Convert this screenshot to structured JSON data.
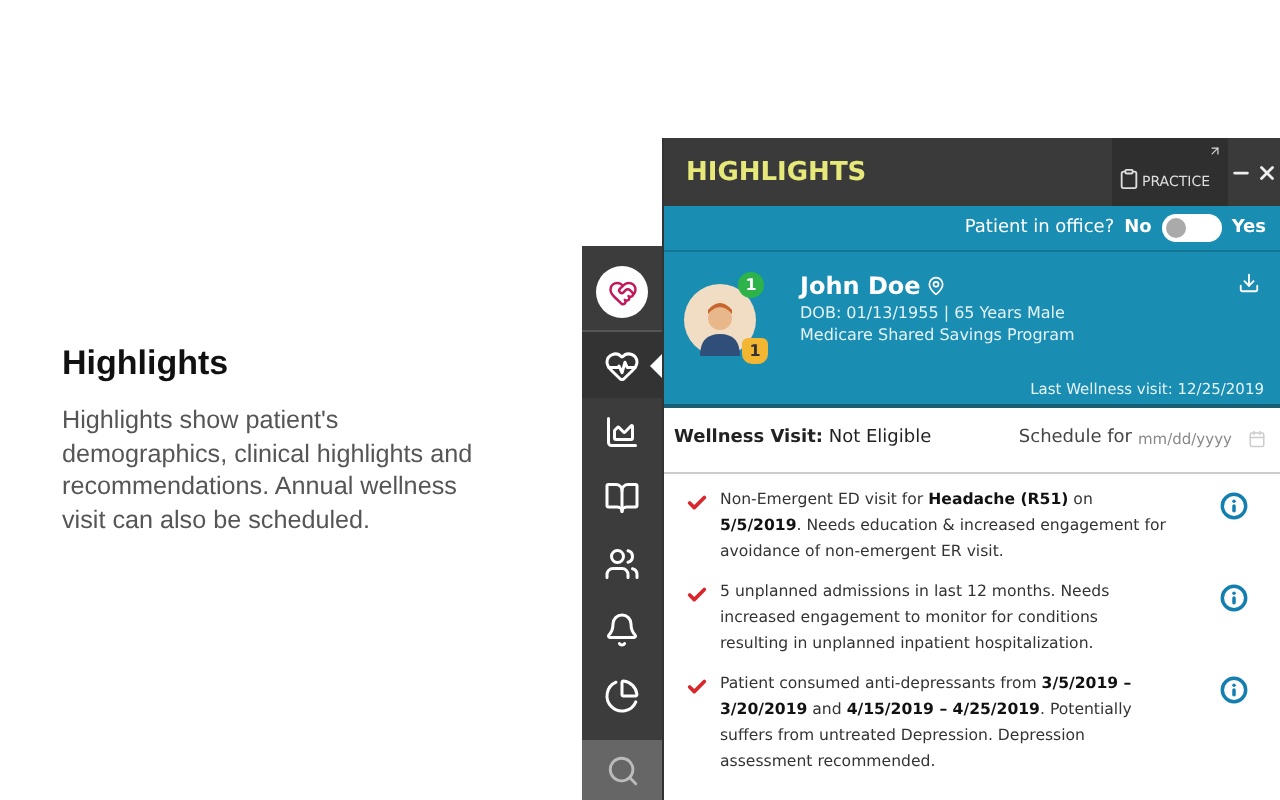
{
  "intro": {
    "title": "Highlights",
    "text": "Highlights show patient's demographics, clinical highlights and recommendations. Annual wellness visit can also be scheduled."
  },
  "sidebar": {
    "items": [
      {
        "selected": true
      },
      {
        "selected": false
      },
      {
        "selected": false
      },
      {
        "selected": false
      },
      {
        "selected": false
      },
      {
        "selected": false
      }
    ]
  },
  "panel": {
    "title": "HIGHLIGHTS",
    "practice_label": "PRACTICE",
    "office": {
      "question": "Patient in office?",
      "off_label": "No",
      "on_label": "Yes",
      "on": false
    },
    "patient": {
      "name": "John Doe",
      "details": "DOB: 01/13/1955 | 65 Years Male",
      "program": "Medicare Shared Savings Program",
      "message_count": "1",
      "alert_count": "1",
      "last_visit": "Last Wellness visit: 12/25/2019"
    },
    "wellness": {
      "label": "Wellness Visit:",
      "value": "Not Eligible",
      "schedule_label": "Schedule for",
      "placeholder": "mm/dd/yyyy"
    },
    "highlights": [
      {
        "text": "Non-Emergent ED visit for **Headache (R51)** on **5/5/2019**. Needs education & increased engagement for avoidance of non-emergent ER visit."
      },
      {
        "text": "5 unplanned admissions in last 12 months. Needs increased engagement to monitor for conditions resulting in unplanned inpatient hospitalization."
      },
      {
        "text": "Patient consumed anti-depressants from **3/5/2019 – 3/20/2019** and **4/15/2019 – 4/25/2019**. Potentially suffers from untreated Depression. Depression assessment recommended."
      }
    ]
  }
}
